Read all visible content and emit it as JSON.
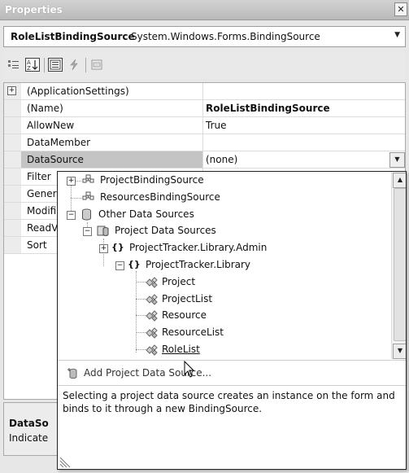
{
  "window": {
    "title": "Properties",
    "close_glyph": "✕"
  },
  "object_selector": {
    "name": "RoleListBindingSource",
    "type": "System.Windows.Forms.BindingSource"
  },
  "toolbar": {
    "buttons": [
      "categorized-icon",
      "alphabetical-icon",
      "properties-icon",
      "events-icon",
      "property-pages-icon"
    ],
    "active": "alphabetical"
  },
  "grid": {
    "rows": [
      {
        "name": "(ApplicationSettings)",
        "value": "",
        "expandable": true
      },
      {
        "name": "(Name)",
        "value": "RoleListBindingSource"
      },
      {
        "name": "AllowNew",
        "value": "True"
      },
      {
        "name": "DataMember",
        "value": ""
      },
      {
        "name": "DataSource",
        "value": "(none)",
        "selected": true
      },
      {
        "name": "Filter",
        "value": ""
      },
      {
        "name": "Gener",
        "value": ""
      },
      {
        "name": "Modifi",
        "value": ""
      },
      {
        "name": "ReadV",
        "value": ""
      },
      {
        "name": "Sort",
        "value": ""
      }
    ]
  },
  "description": {
    "title": "DataSo",
    "text": "Indicate"
  },
  "popup": {
    "tree": [
      {
        "label": "ProjectBindingSource",
        "icon": "binding-source-icon"
      },
      {
        "label": "ResourcesBindingSource",
        "icon": "binding-source-icon"
      },
      {
        "label": "Other Data Sources",
        "icon": "database-icon"
      },
      {
        "label": "Project Data Sources",
        "icon": "project-data-sources-icon"
      },
      {
        "label": "ProjectTracker.Library.Admin",
        "icon": "namespace-icon"
      },
      {
        "label": "ProjectTracker.Library",
        "icon": "namespace-icon"
      },
      {
        "label": "Project",
        "icon": "class-icon"
      },
      {
        "label": "ProjectList",
        "icon": "class-icon"
      },
      {
        "label": "Resource",
        "icon": "class-icon"
      },
      {
        "label": "ResourceList",
        "icon": "class-icon"
      },
      {
        "label": "RoleList",
        "icon": "class-icon"
      }
    ],
    "add_label": "Add Project Data Source...",
    "help_text": "Selecting a project data source creates an instance on the form and binds to it through a new BindingSource."
  },
  "colors": {
    "selected_row": "#c4c4c4",
    "popup_border": "#222222"
  }
}
